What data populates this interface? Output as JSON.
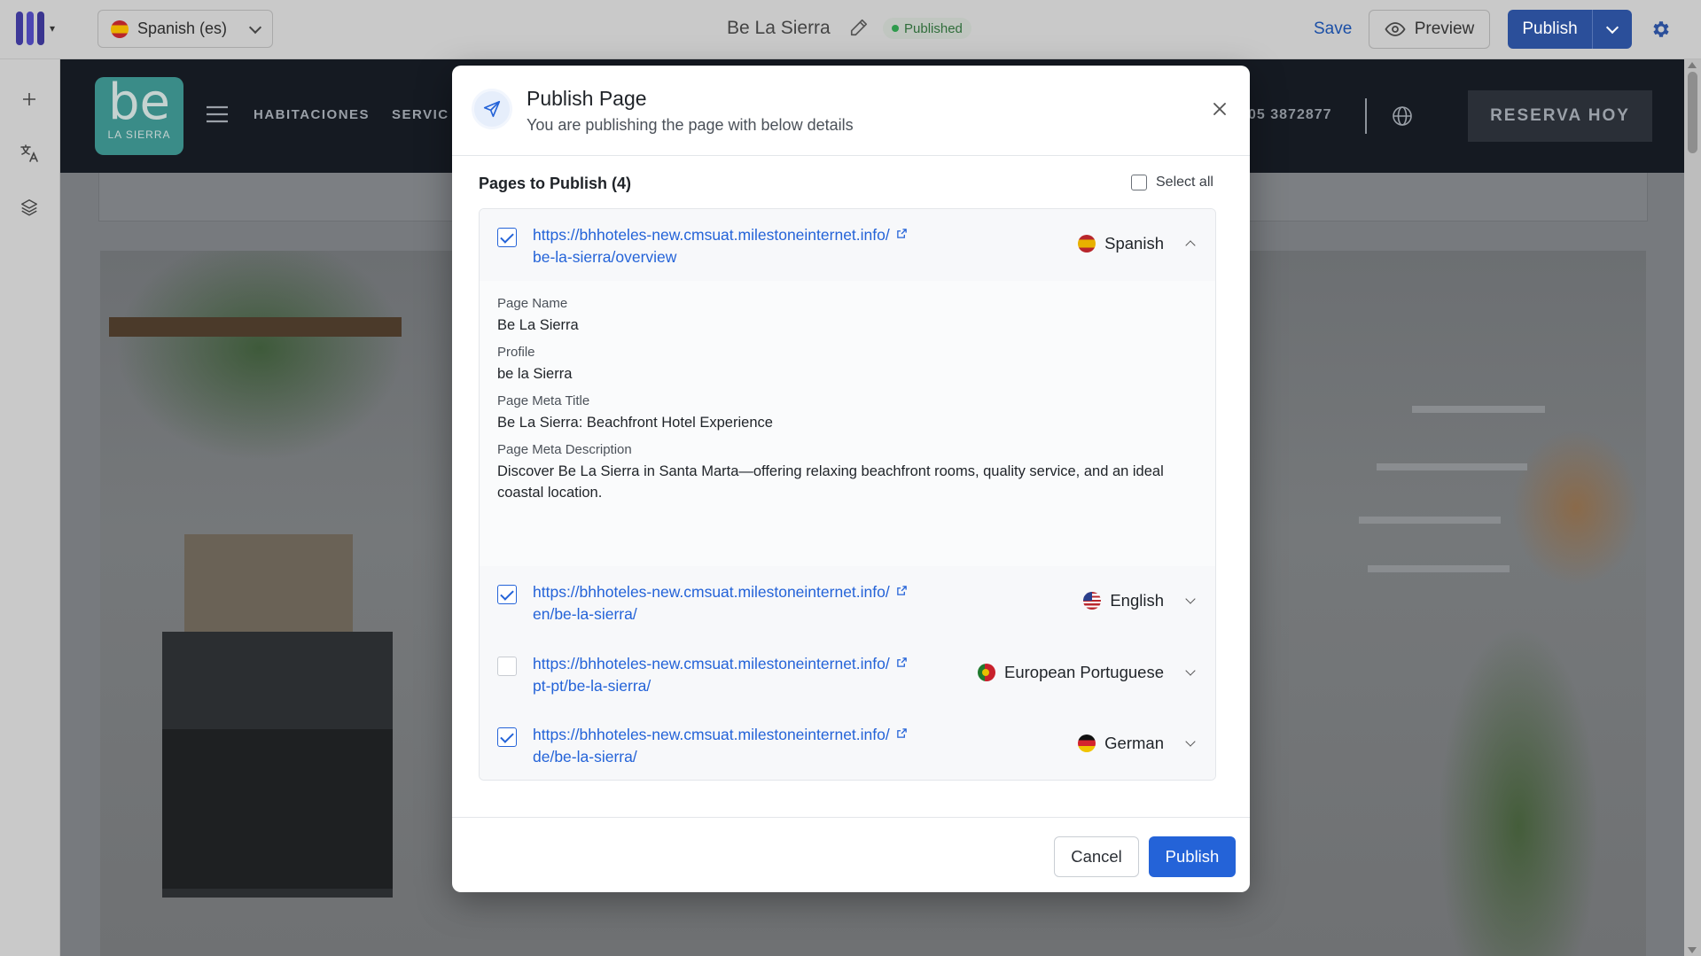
{
  "topbar": {
    "language_selector": {
      "flag": "es",
      "label": "Spanish (es)"
    },
    "page_title": "Be La Sierra",
    "status_badge": "Published",
    "save_label": "Save",
    "preview_label": "Preview",
    "publish_label": "Publish"
  },
  "site": {
    "logo_text": "be",
    "logo_sub": "LA SIERRA",
    "nav": [
      "HABITACIONES",
      "SERVIC"
    ],
    "phone": "05 3872877",
    "reserve_label": "RESERVA HOY"
  },
  "modal": {
    "title": "Publish Page",
    "subtitle": "You are publishing the page with below details",
    "pages_heading": "Pages to Publish (4)",
    "select_all_label": "Select all",
    "pages": [
      {
        "checked": true,
        "url_line1": "https://bhhoteles-new.cmsuat.milestoneinternet.info/",
        "url_line2": "be-la-sierra/overview",
        "language": "Spanish",
        "flag": "es",
        "expanded": true
      },
      {
        "checked": true,
        "url_line1": "https://bhhoteles-new.cmsuat.milestoneinternet.info/",
        "url_line2": "en/be-la-sierra/",
        "language": "English",
        "flag": "us",
        "expanded": false
      },
      {
        "checked": false,
        "url_line1": "https://bhhoteles-new.cmsuat.milestoneinternet.info/",
        "url_line2": "pt-pt/be-la-sierra/",
        "language": "European Portuguese",
        "flag": "pt",
        "expanded": false
      },
      {
        "checked": true,
        "url_line1": "https://bhhoteles-new.cmsuat.milestoneinternet.info/",
        "url_line2": "de/be-la-sierra/",
        "language": "German",
        "flag": "de",
        "expanded": false
      }
    ],
    "details": {
      "page_name_label": "Page Name",
      "page_name": "Be La Sierra",
      "profile_label": "Profile",
      "profile": "be la Sierra",
      "meta_title_label": "Page Meta Title",
      "meta_title": "Be La Sierra: Beachfront Hotel Experience",
      "meta_description_label": "Page Meta Description",
      "meta_description": "Discover Be La Sierra in Santa Marta—offering relaxing beachfront rooms, quality service, and an ideal coastal location."
    },
    "cancel_label": "Cancel",
    "publish_label": "Publish"
  },
  "colors": {
    "primary": "#2463d8",
    "top_publish": "#2b4f9a",
    "status_green": "#2e9b4c",
    "logo_teal": "#3a8c88"
  },
  "icons": [
    "app-logo-icon",
    "pencil-icon",
    "eye-icon",
    "gear-icon",
    "plus-icon",
    "translate-icon",
    "layers-icon",
    "hamburger-icon",
    "globe-icon",
    "send-icon",
    "close-icon",
    "external-link-icon",
    "chevron-down-icon",
    "chevron-up-icon"
  ]
}
